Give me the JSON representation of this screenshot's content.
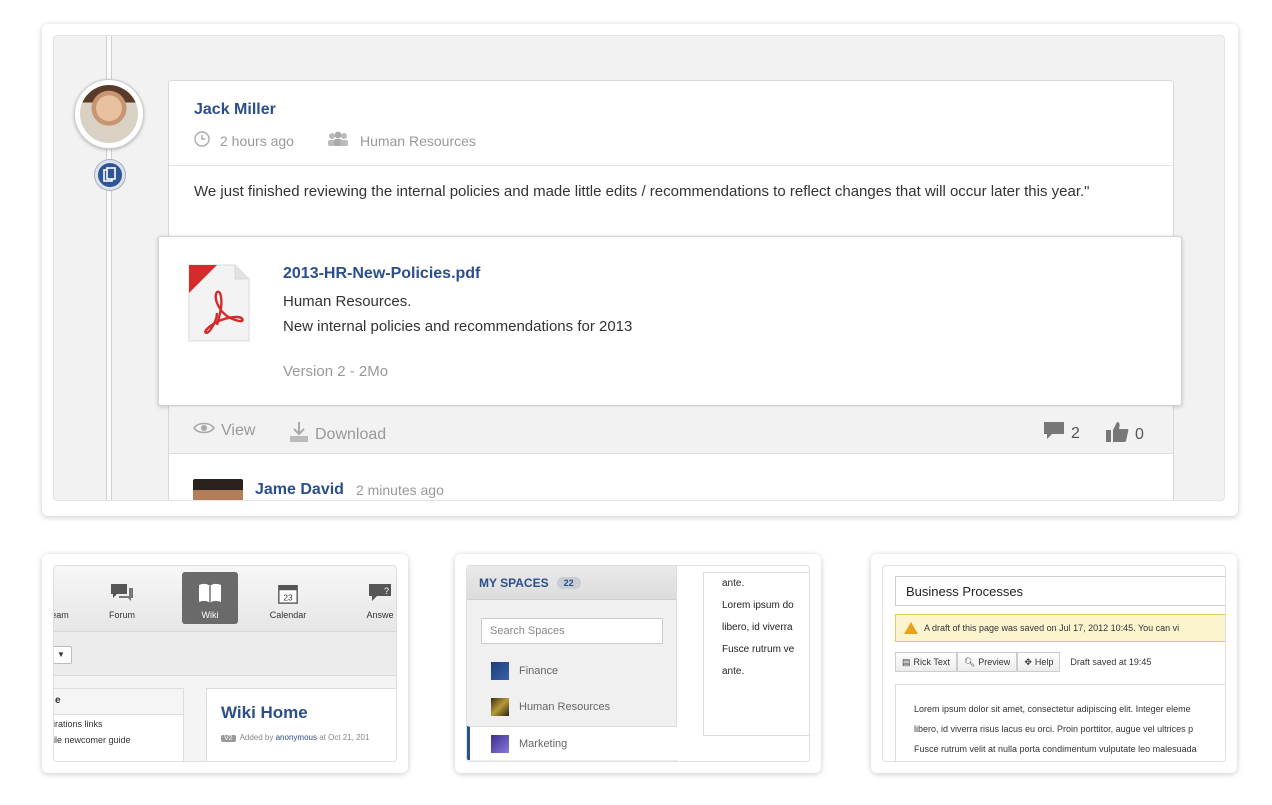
{
  "activity": {
    "author": "Jack Miller",
    "time": "2 hours ago",
    "space": "Human Resources",
    "text": "We just finished reviewing the internal policies and made little edits / recommendations to reflect changes that will occur later this year.\"",
    "attachment": {
      "file_name": "2013-HR-New-Policies.pdf",
      "desc_line1": "Human Resources.",
      "desc_line2": "New internal policies and recommendations for 2013",
      "version": "Version 2 - 2Mo"
    },
    "actions": {
      "view": "View",
      "download": "Download",
      "comments": "2",
      "likes": "0"
    },
    "comment": {
      "author": "Jame David",
      "time": "2 minutes ago"
    }
  },
  "wiki": {
    "toolbar": [
      "eam",
      "Forum",
      "Wiki",
      "Calendar",
      "Answe"
    ],
    "calendar_day": "23",
    "side_head": "e",
    "side_items": [
      "irations links",
      "ile newcomer guide"
    ],
    "title": "Wiki Home",
    "meta_tag": "V2",
    "meta_prefix": "Added by",
    "meta_user": "anonymous",
    "meta_date": "at Oct 21, 201"
  },
  "spaces": {
    "title": "MY SPACES",
    "count": "22",
    "search_placeholder": "Search Spaces",
    "items": [
      "Finance",
      "Human Resources",
      "Marketing"
    ],
    "lorem": [
      "ante.",
      "Lorem ipsum do",
      "libero, id viverra",
      "Fusce rutrum ve",
      "ante."
    ]
  },
  "process": {
    "title": "Business Processes",
    "warning": "A draft of this page was saved on Jul 17, 2012 10:45. You can vi",
    "buttons": [
      "Rick Text",
      "Preview",
      "Help"
    ],
    "saved": "Draft saved at 19:45",
    "lines": [
      "Lorem ipsum dolor sit amet, consectetur adipiscing elit. Integer eleme",
      "libero, id viverra risus lacus eu orci. Proin porttitor, augue vel ultrices p",
      "Fusce rutrum velit at nulla porta condimentum vulputate leo malesuada"
    ]
  },
  "colors": {
    "link_blue": "#2b4e8c",
    "pdf_red": "#d42b2b",
    "warning_bg": "#fcf4cf"
  }
}
